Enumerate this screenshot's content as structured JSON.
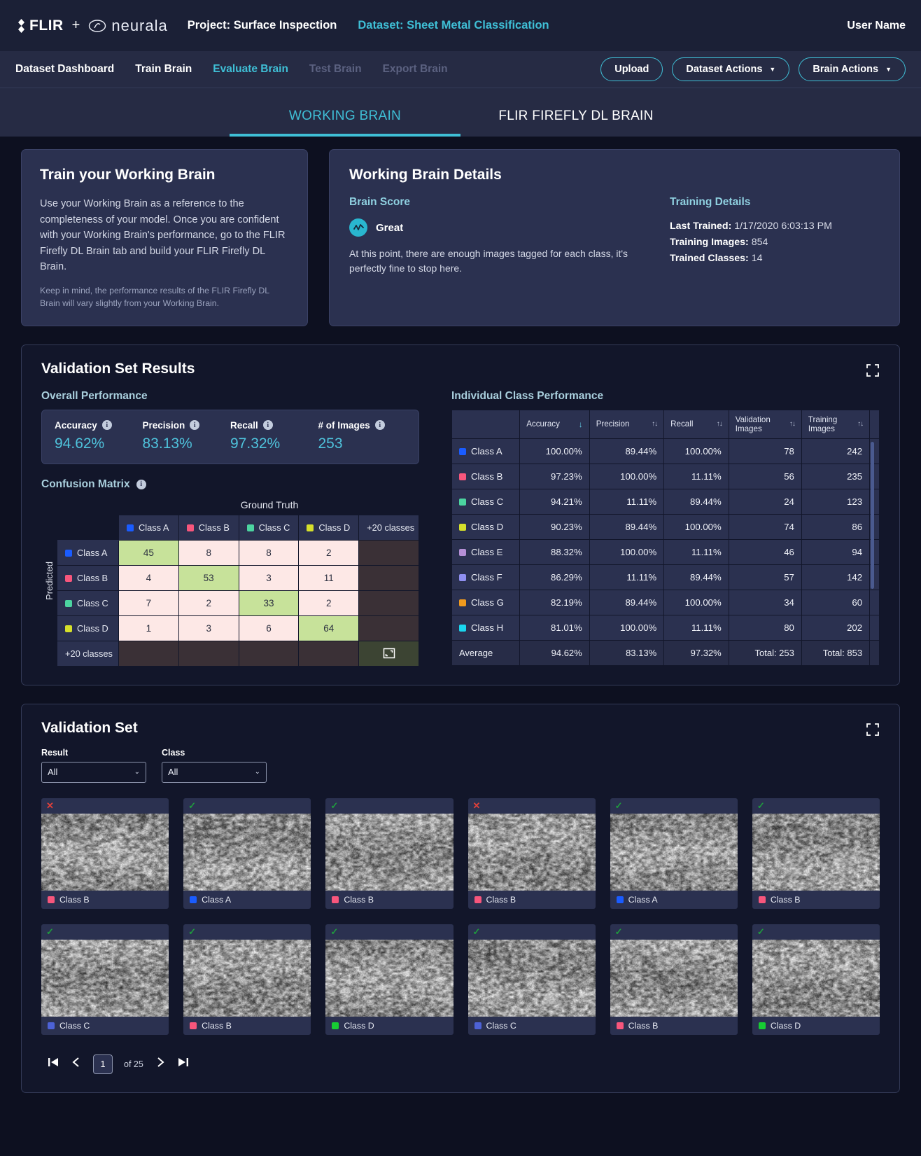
{
  "topbar": {
    "flir_logo_text": "FLIR",
    "plus": "+",
    "neurala_text": "neurala",
    "project": "Project: Surface Inspection",
    "dataset": "Dataset: Sheet Metal Classification",
    "user": "User Name"
  },
  "nav": {
    "items": [
      {
        "label": "Dataset Dashboard",
        "state": "normal"
      },
      {
        "label": "Train Brain",
        "state": "normal"
      },
      {
        "label": "Evaluate Brain",
        "state": "active"
      },
      {
        "label": "Test Brain",
        "state": "disabled"
      },
      {
        "label": "Export Brain",
        "state": "disabled"
      }
    ],
    "upload": "Upload",
    "dataset_actions": "Dataset Actions",
    "brain_actions": "Brain Actions"
  },
  "brain_tabs": [
    {
      "label": "WORKING BRAIN",
      "active": true
    },
    {
      "label": "FLIR FIREFLY DL BRAIN",
      "active": false
    }
  ],
  "train_card": {
    "title": "Train your Working Brain",
    "body": "Use your Working Brain as a reference to the completeness of your model. Once you are confident with your Working Brain's performance, go to the FLIR Firefly DL Brain tab and build your FLIR Firefly DL Brain.",
    "note": "Keep in mind, the performance results of the FLIR Firefly DL Brain will vary slightly from your Working Brain."
  },
  "details_card": {
    "title": "Working Brain Details",
    "brain_score_heading": "Brain Score",
    "score_label": "Great",
    "score_icon": "pulse-icon",
    "score_desc": "At this point, there are enough images tagged for each class, it's perfectly fine to stop here.",
    "training_heading": "Training Details",
    "last_trained_label": "Last Trained:",
    "last_trained_value": "1/17/2020 6:03:13 PM",
    "training_images_label": "Training Images:",
    "training_images_value": "854",
    "trained_classes_label": "Trained Classes:",
    "trained_classes_value": "14"
  },
  "validation_results": {
    "title": "Validation Set Results",
    "overall_heading": "Overall Performance",
    "overall": [
      {
        "label": "Accuracy",
        "value": "94.62%"
      },
      {
        "label": "Precision",
        "value": "83.13%"
      },
      {
        "label": "Recall",
        "value": "97.32%"
      },
      {
        "label": "# of Images",
        "value": "253"
      }
    ],
    "confusion_heading": "Confusion Matrix",
    "individual_heading": "Individual Class Performance"
  },
  "chart_data": {
    "type": "heatmap",
    "title": "Confusion Matrix",
    "xlabel": "Ground Truth",
    "ylabel": "Predicted",
    "overflow_label": "+20 classes",
    "categories": [
      "Class A",
      "Class B",
      "Class C",
      "Class D"
    ],
    "category_colors": [
      "#1a5cff",
      "#f7567c",
      "#4cd4a0",
      "#d6e02b"
    ],
    "matrix": [
      [
        45,
        8,
        8,
        2
      ],
      [
        4,
        53,
        3,
        11
      ],
      [
        7,
        2,
        33,
        2
      ],
      [
        1,
        3,
        6,
        64
      ]
    ],
    "diag_color": "#c7e29a",
    "offdiag_color": "#fde8e6"
  },
  "icp_table": {
    "columns": [
      "",
      "Accuracy",
      "Precision",
      "Recall",
      "Validation Images",
      "Training Images"
    ],
    "sort": {
      "column": "Accuracy",
      "direction": "descending"
    },
    "rows": [
      {
        "class": "Class A",
        "color": "#1a5cff",
        "accuracy": "100.00%",
        "precision": "89.44%",
        "recall": "100.00%",
        "validation_images": "78",
        "training_images": "242"
      },
      {
        "class": "Class B",
        "color": "#f7567c",
        "accuracy": "97.23%",
        "precision": "100.00%",
        "recall": "11.11%",
        "validation_images": "56",
        "training_images": "235"
      },
      {
        "class": "Class C",
        "color": "#4cd4a0",
        "accuracy": "94.21%",
        "precision": "11.11%",
        "recall": "89.44%",
        "validation_images": "24",
        "training_images": "123"
      },
      {
        "class": "Class D",
        "color": "#d6e02b",
        "accuracy": "90.23%",
        "precision": "89.44%",
        "recall": "100.00%",
        "validation_images": "74",
        "training_images": "86"
      },
      {
        "class": "Class E",
        "color": "#b58fd6",
        "accuracy": "88.32%",
        "precision": "100.00%",
        "recall": "11.11%",
        "validation_images": "46",
        "training_images": "94"
      },
      {
        "class": "Class F",
        "color": "#8f8ff0",
        "accuracy": "86.29%",
        "precision": "11.11%",
        "recall": "89.44%",
        "validation_images": "57",
        "training_images": "142"
      },
      {
        "class": "Class G",
        "color": "#f09a1e",
        "accuracy": "82.19%",
        "precision": "89.44%",
        "recall": "100.00%",
        "validation_images": "34",
        "training_images": "60"
      },
      {
        "class": "Class H",
        "color": "#1ad6ee",
        "accuracy": "81.01%",
        "precision": "100.00%",
        "recall": "11.11%",
        "validation_images": "80",
        "training_images": "202"
      }
    ],
    "average_row": {
      "label": "Average",
      "accuracy": "94.62%",
      "precision": "83.13%",
      "recall": "97.32%",
      "validation_images": "Total: 253",
      "training_images": "Total: 853"
    }
  },
  "validation_set": {
    "title": "Validation Set",
    "filters": [
      {
        "label": "Result",
        "value": "All"
      },
      {
        "label": "Class",
        "value": "All"
      }
    ],
    "tiles": [
      {
        "status": "incorrect",
        "class": "Class B",
        "color": "#f7567c",
        "seed": 11
      },
      {
        "status": "correct",
        "class": "Class A",
        "color": "#1a5cff",
        "seed": 22
      },
      {
        "status": "correct",
        "class": "Class B",
        "color": "#f7567c",
        "seed": 33
      },
      {
        "status": "incorrect",
        "class": "Class B",
        "color": "#f7567c",
        "seed": 44
      },
      {
        "status": "correct",
        "class": "Class A",
        "color": "#1a5cff",
        "seed": 55
      },
      {
        "status": "correct",
        "class": "Class B",
        "color": "#f7567c",
        "seed": 66
      },
      {
        "status": "correct",
        "class": "Class C",
        "color": "#4d62d6",
        "seed": 77
      },
      {
        "status": "correct",
        "class": "Class B",
        "color": "#f7567c",
        "seed": 88
      },
      {
        "status": "correct",
        "class": "Class D",
        "color": "#17cc33",
        "seed": 99
      },
      {
        "status": "correct",
        "class": "Class C",
        "color": "#4d62d6",
        "seed": 110
      },
      {
        "status": "correct",
        "class": "Class B",
        "color": "#f7567c",
        "seed": 121
      },
      {
        "status": "correct",
        "class": "Class D",
        "color": "#17cc33",
        "seed": 132
      }
    ],
    "pagination": {
      "first_icon": "first-page-icon",
      "prev_icon": "prev-page-icon",
      "current_page": "1",
      "of_text": "of 25",
      "next_icon": "next-page-icon",
      "last_icon": "last-page-icon"
    }
  }
}
